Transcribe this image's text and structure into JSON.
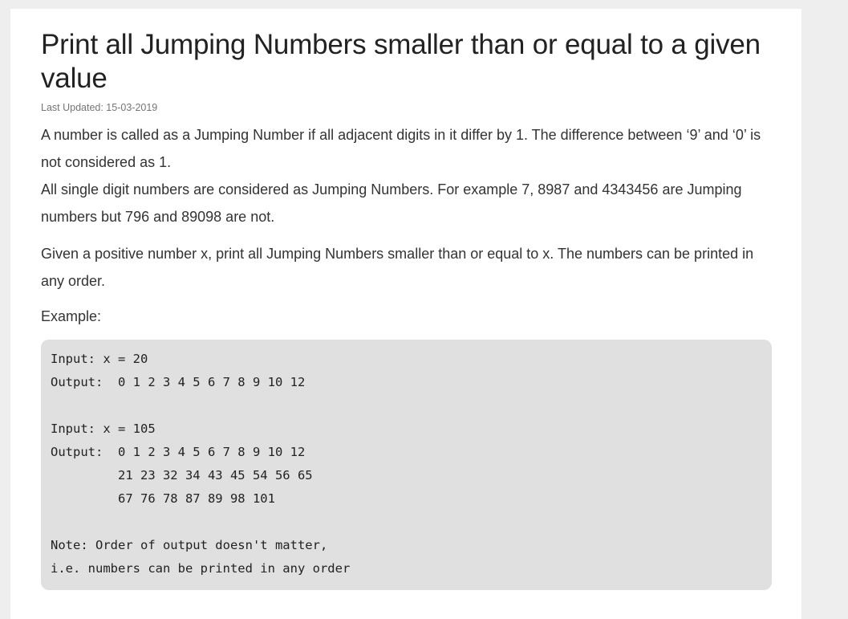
{
  "article": {
    "title": "Print all Jumping Numbers smaller than or equal to a given value",
    "last_updated": "Last Updated: 15-03-2019",
    "para1_line1": "A number is called as a Jumping Number if all adjacent digits in it differ by 1. The difference between ‘9’ and ‘0’ is not considered as 1.",
    "para1_line2": "All single digit numbers are considered as Jumping Numbers. For example 7, 8987 and 4343456 are Jumping numbers but 796 and 89098 are not.",
    "para2": "Given a positive number x, print all Jumping Numbers smaller than or equal to x. The numbers can be printed in any order.",
    "example_label": "Example:",
    "code_lines": [
      "Input: x = 20",
      "Output:  0 1 2 3 4 5 6 7 8 9 10 12",
      "",
      "Input: x = 105",
      "Output:  0 1 2 3 4 5 6 7 8 9 10 12",
      "         21 23 32 34 43 45 54 56 65",
      "         67 76 78 87 89 98 101",
      "",
      "Note: Order of output doesn't matter,",
      "i.e. numbers can be printed in any order"
    ]
  }
}
